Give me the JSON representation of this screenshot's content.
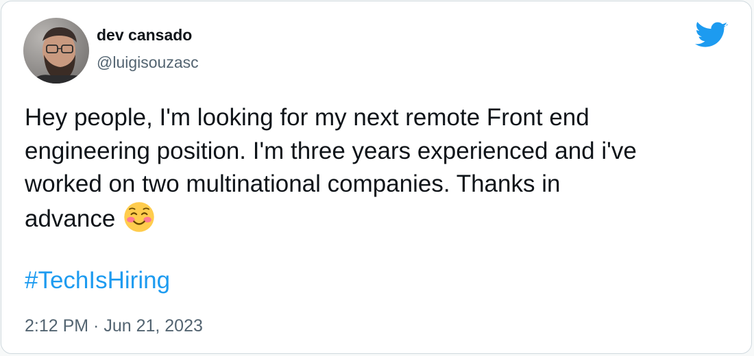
{
  "tweet": {
    "author": {
      "display_name": "dev cansado",
      "handle": "@luigisouzasc"
    },
    "text_lines": [
      "Hey people, I'm looking for my next remote Front end",
      "engineering position. I'm three years experienced and i've",
      "worked on two multinational companies. Thanks in",
      "advance"
    ],
    "emoji": "smiling-face-with-blush",
    "hashtag": "#TechIsHiring",
    "timestamp": "2:12 PM · Jun 21, 2023"
  },
  "colors": {
    "text": "#0f1419",
    "secondary": "#536471",
    "link": "#1d9bf0",
    "twitter_brand": "#1d9bf0",
    "border": "#cfd9de"
  },
  "icons": {
    "brand": "twitter-bird-icon",
    "avatar": "user-avatar"
  }
}
